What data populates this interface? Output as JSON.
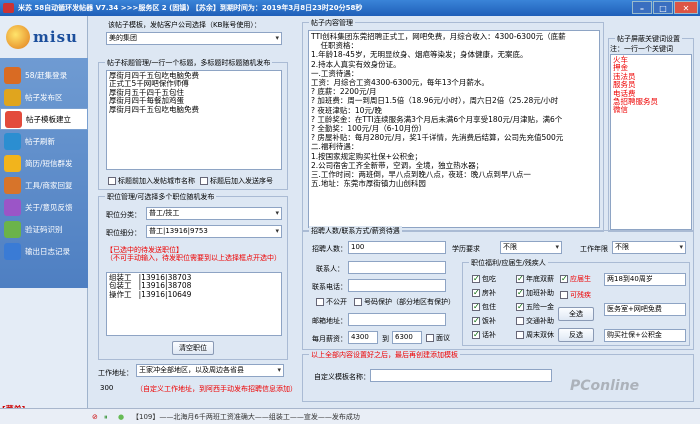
{
  "window": {
    "title": "米苏 58自动循环发帖器 V7.34 >>>服务区 2 (固镇) 【苏余】到期时间为：2019年3月8日23时20分58秒"
  },
  "brand": {
    "logo_text": "misu"
  },
  "nav": [
    {
      "label": "58/赶集登录",
      "icon": "user-icon",
      "color": "#d96b23"
    },
    {
      "label": "帖子发布区",
      "icon": "edit-icon",
      "color": "#e0a51e"
    },
    {
      "label": "帖子模板建立",
      "icon": "template-icon",
      "color": "#e34b3c"
    },
    {
      "label": "帖子刷新",
      "icon": "refresh-icon",
      "color": "#2b8ed1"
    },
    {
      "label": "简历/短信群发",
      "icon": "mail-icon",
      "color": "#f2b41c"
    },
    {
      "label": "工具/商家回复",
      "icon": "tool-icon",
      "color": "#d7742a"
    },
    {
      "label": "关于/意见反馈",
      "icon": "info-icon",
      "color": "#9b55c7"
    },
    {
      "label": "验证码识别",
      "icon": "captcha-icon",
      "color": "#6bb34a"
    },
    {
      "label": "输出日志记录",
      "icon": "log-icon",
      "color": "#3a7bd5"
    }
  ],
  "left": {
    "template_label": "该帖子模板，发帖客户公司选择（KB账号使用）：",
    "company_value": "美的集团",
    "title_group_label": "帖子标题管理/一行一个标题，多标题时标题随机发布",
    "titles": "厚街月四千五包吃电脑免费\n正式工5千网吧保作师傅\n厚街月五千四千五包住\n厚街月四千每餐加鸡蛋\n厚街月四千五包吃电脑免费",
    "chk_prefix_city": "标题前加入发帖城市名称",
    "chk_suffix_seq": "标题后加入发送序号",
    "position_group_label": "职位管理/可选择多个职位随机发布",
    "cat_label": "职位分类：",
    "cat_value": "普工/技工",
    "sub_label": "职位细分：",
    "sub_value": "普工|13916|9753",
    "pos_note": "【已选中的待发送职位】\n（不可手动输入，待发职位需要到以上选择框点开选中）",
    "positions": "组装工   |13916|38703\n包装工   |13916|38708\n操作工   |13916|10649",
    "clear_btn": "清空职位",
    "work_addr_label": "工作地址：",
    "work_addr_value": "王家冲全部地区，以及周边各省县",
    "count": "300",
    "work_note": "（自定义工作地址，到阿西手动发布招聘信息添加）"
  },
  "content": {
    "group_label": "帖子内容管理",
    "body": "TTI创科集团东莞招聘正式工，网吧免费，月综合收入：4300-6300元（底薪\n    任职资格：\n1.年龄18-45岁，无明显纹身、烟疤等染发；身体健康，无案底。\n2.持本人真实有效身份证。\n一.工资待遇：\n工资：月综合工资4300-6300元，每年13个月薪水。\n? 底薪：2200元/月\n? 加班费：周一到周日1.5倍（18.96元/小时），周六日2倍（25.28元/小时\n? 夜班津贴：10元/晚\n? 工龄奖金：在TTI连续服务满3个月后未满6个月享受180元/月津贴，满6个\n? 全勤奖：100元/月（6-10月份）\n? 房屋补贴：每月280元/月，奖1千详情，先消费后结算，公司先充值500元\n二.福利待遇：\n1.按国家规定购买社保+公积金；\n2.公司宿舍工齐全新带，空调，全境，独立热水器；\n三.工作时间：两班倒，早八点到晚八点，夜班：晚八点到早八点一\n五.地址：东莞市厚街镇力山创科园"
  },
  "keywords": {
    "group_label": "帖子屏蔽关键词设置",
    "hint": "注：一行一个关键词",
    "list": "火车\n押金\n违法员\n服务员\n电话费\n急招聘服务员\n微信"
  },
  "contact": {
    "group_label": "招聘人数/联系方式/薪资待遇",
    "num_label": "招聘人数：",
    "num_value": "100",
    "edu_label": "学历要求",
    "edu_value": "不限",
    "exp_label": "工作年限",
    "exp_value": "不限",
    "person_label": "联系人：",
    "person_value": "",
    "phone_label": "联系电话：",
    "phone_value": "",
    "chk_hide": "不公开",
    "chk_protect": "号码保护（部分地区有保护）",
    "email_label": "邮箱地址：",
    "email_value": "",
    "salary_label": "每月薪资：",
    "salary_min": "4300",
    "salary_to": "到",
    "salary_max": "6300",
    "chk_negotiable": "面议",
    "welfare_group_label": "职位福利/应届生/残疾人",
    "welfare": [
      {
        "label": "包吃",
        "checked": true
      },
      {
        "label": "年底双薪",
        "checked": true
      },
      {
        "label": "房补",
        "checked": true
      },
      {
        "label": "加班补助",
        "checked": true
      },
      {
        "label": "包住",
        "checked": true
      },
      {
        "label": "五险一金",
        "checked": true
      },
      {
        "label": "饭补",
        "checked": true
      },
      {
        "label": "交通补助",
        "checked": false
      },
      {
        "label": "话补",
        "checked": true
      },
      {
        "label": "周末双休",
        "checked": false
      }
    ],
    "fresh_grad": "应届生",
    "disabled": "可残疾",
    "select_all": "全选",
    "invert": "反选",
    "side_fields": [
      "两18到40周岁",
      "医务室+网吧免费",
      "购买社保+公积金"
    ]
  },
  "custom": {
    "note": "以上全部内容设置好之后，最后再创建添加模板",
    "name_label": "自定义模板名称："
  },
  "status": {
    "menu": "[菜单]",
    "items": [
      "【109】——北海月6千两班工资准确大——组装工——宣发——发布成功"
    ]
  },
  "watermark": "PConline"
}
